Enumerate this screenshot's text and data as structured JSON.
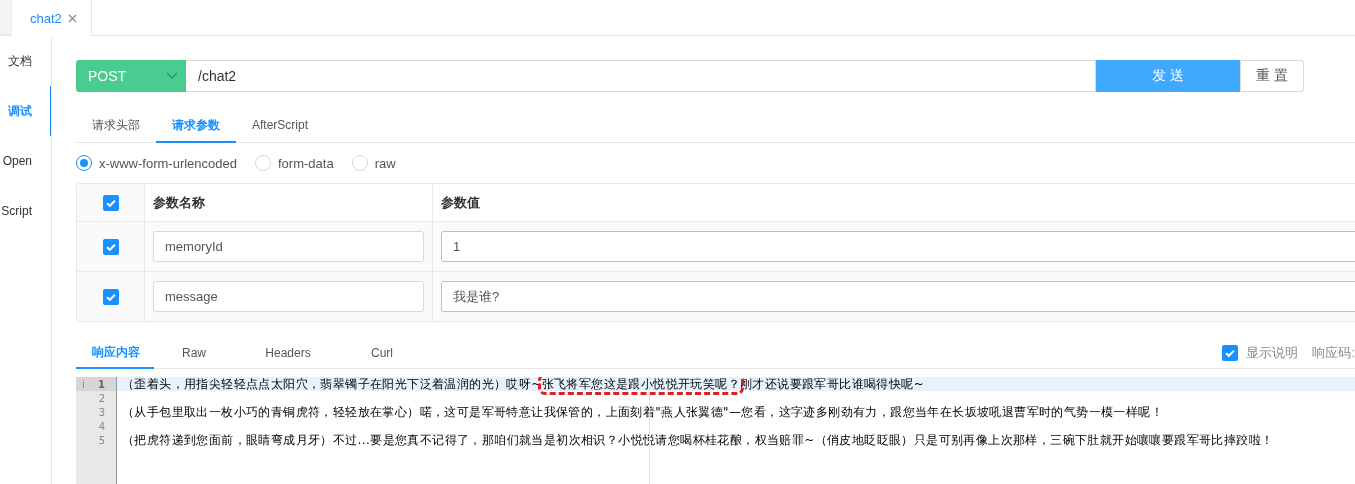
{
  "doc_tabs": [
    {
      "label": "chat2",
      "selected": true,
      "closable": true
    }
  ],
  "sidebar": {
    "items": [
      {
        "label": "文档",
        "selected": false
      },
      {
        "label": "调试",
        "selected": true
      },
      {
        "label": "Open",
        "selected": false
      },
      {
        "label": "Script",
        "selected": false
      }
    ]
  },
  "request": {
    "method": "POST",
    "url": "/chat2",
    "send_button": "发 送",
    "reset_button": "重 置",
    "tabs": [
      {
        "label": "请求头部",
        "selected": false
      },
      {
        "label": "请求参数",
        "selected": true
      },
      {
        "label": "AfterScript",
        "selected": false
      }
    ],
    "body_types": [
      {
        "label": "x-www-form-urlencoded",
        "selected": true
      },
      {
        "label": "form-data",
        "selected": false
      },
      {
        "label": "raw",
        "selected": false
      }
    ],
    "params": {
      "all_checked": true,
      "columns": [
        "参数名称",
        "参数值"
      ],
      "rows": [
        {
          "checked": true,
          "name": "memoryId",
          "value": "1"
        },
        {
          "checked": true,
          "name": "message",
          "value": "我是谁?"
        }
      ]
    }
  },
  "response": {
    "tabs": [
      {
        "label": "响应内容",
        "selected": true
      },
      {
        "label": "Raw",
        "selected": false
      },
      {
        "label": "Headers",
        "selected": false
      },
      {
        "label": "Curl",
        "selected": false
      }
    ],
    "show_description": {
      "label": "显示说明",
      "checked": true
    },
    "status_label": "响应码:",
    "editor": {
      "lines": [
        {
          "number": "1",
          "current": true,
          "info": "i",
          "segments": [
            {
              "text": "（歪着头，用指尖轻轻点点太阳穴，翡翠镯子在阳光下泛着温润的光）哎呀~",
              "highlighted": false
            },
            {
              "text": "张飞将军您这是跟小悦悦开玩笑呢？",
              "highlighted": true
            },
            {
              "text": "刚才还说要跟军哥比谁喝得快呢~",
              "highlighted": false
            }
          ]
        },
        {
          "number": "2",
          "current": false
        },
        {
          "number": "3",
          "current": false,
          "segments": [
            {
              "text": "（从手包里取出一枚小巧的青铜虎符，轻轻放在掌心）喏，这可是军哥特意让我保管的，上面刻着\"燕人张翼德\"—您看，这字迹多刚劲有力，跟您当年在长坂坡吼退曹军时的气势一模一样呢！",
              "highlighted": false
            }
          ]
        },
        {
          "number": "4",
          "current": false
        },
        {
          "number": "5",
          "current": false,
          "segments": [
            {
              "text": "（把虎符递到您面前，眼睛弯成月牙）不过...要是您真不记得了，那咱们就当是初次相识？小悦悦请您喝杯桂花酿，权当赔罪~（俏皮地眨眨眼）只是可别再像上次那样，三碗下肚就开始嚷嚷要跟军哥比摔跤啦！",
              "highlighted": false
            }
          ]
        }
      ]
    }
  }
}
